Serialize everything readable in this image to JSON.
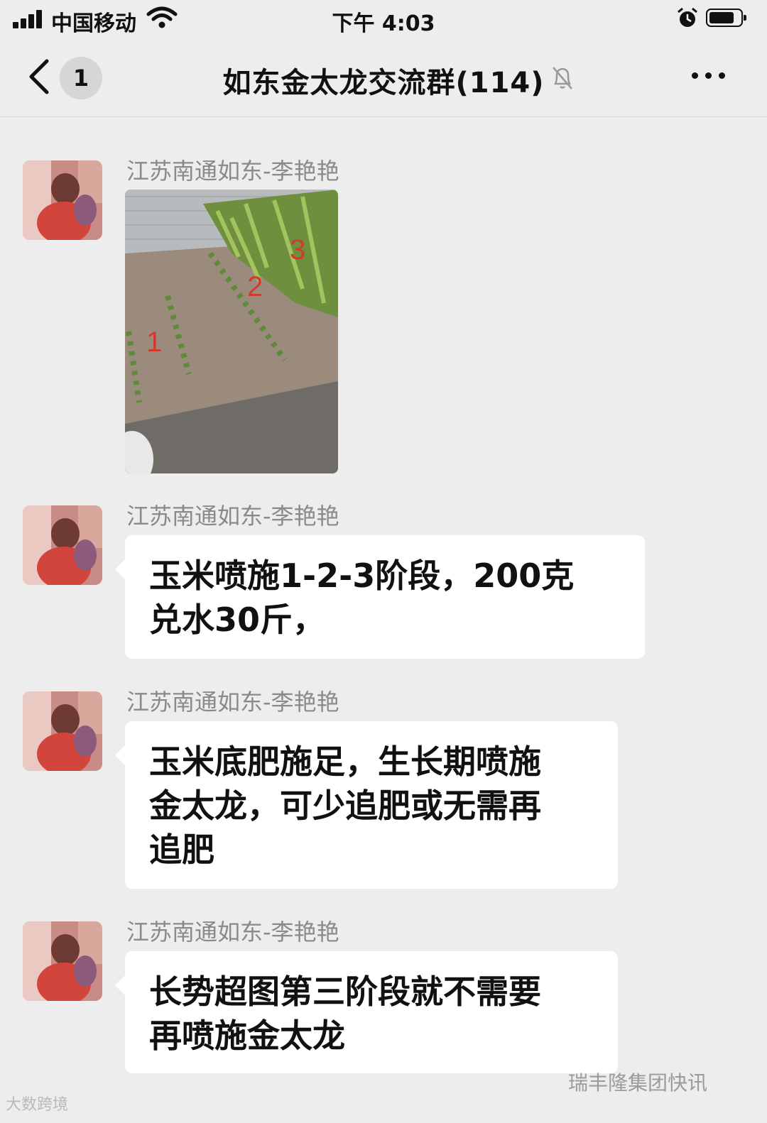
{
  "status_bar": {
    "carrier": "中国移动",
    "time": "下午 4:03",
    "battery_level": 0.7
  },
  "nav": {
    "back_badge": "1",
    "title": "如东金太龙交流群(114)",
    "muted": true
  },
  "messages": [
    {
      "sender": "江苏南通如东-李艳艳",
      "type": "image",
      "image_labels": [
        "1",
        "2",
        "3"
      ]
    },
    {
      "sender": "江苏南通如东-李艳艳",
      "type": "text",
      "lines": [
        "玉米喷施1-2-3阶段，200克",
        "兑水30斤，"
      ]
    },
    {
      "sender": "江苏南通如东-李艳艳",
      "type": "text",
      "lines": [
        "玉米底肥施足，生长期喷施",
        "金太龙，可少追肥或无需再",
        "追肥"
      ]
    },
    {
      "sender": "江苏南通如东-李艳艳",
      "type": "text",
      "lines": [
        "长势超图第三阶段就不需要",
        "再喷施金太龙"
      ]
    }
  ],
  "watermarks": {
    "left": "大数跨境",
    "right": "瑞丰隆集团快讯"
  },
  "colors": {
    "background": "#ededed",
    "bubble": "#ffffff",
    "sender_text": "#8a8a8a"
  }
}
